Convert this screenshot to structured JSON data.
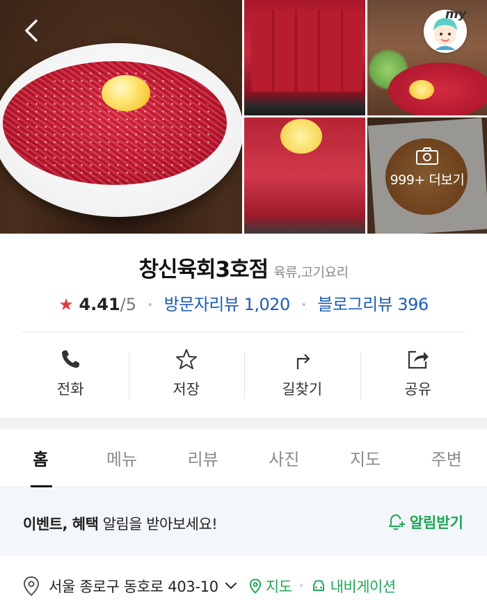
{
  "photos": {
    "more_label": "999+ 더보기",
    "my_label": "my"
  },
  "place": {
    "name": "창신육회3호점",
    "category": "육류,고기요리",
    "rating": "4.41",
    "rating_max": "/5",
    "visitor_review_label": "방문자리뷰 1,020",
    "blog_review_label": "블로그리뷰 396"
  },
  "actions": [
    {
      "label": "전화",
      "icon": "phone-icon"
    },
    {
      "label": "저장",
      "icon": "star-outline-icon"
    },
    {
      "label": "길찾기",
      "icon": "directions-icon"
    },
    {
      "label": "공유",
      "icon": "share-icon"
    }
  ],
  "tabs": [
    {
      "label": "홈",
      "active": true
    },
    {
      "label": "메뉴"
    },
    {
      "label": "리뷰"
    },
    {
      "label": "사진"
    },
    {
      "label": "지도"
    },
    {
      "label": "주변"
    }
  ],
  "notice": {
    "bold_text": "이벤트, 혜택",
    "text": " 알림을 받아보세요!",
    "button_label": "알림받기"
  },
  "address": {
    "text": "서울 종로구 동호로 403-10",
    "map_link": "지도",
    "nav_link": "내비게이션"
  },
  "colors": {
    "link_blue": "#1e5db3",
    "accent_green": "#1ea556",
    "star_red": "#e53a3a"
  }
}
